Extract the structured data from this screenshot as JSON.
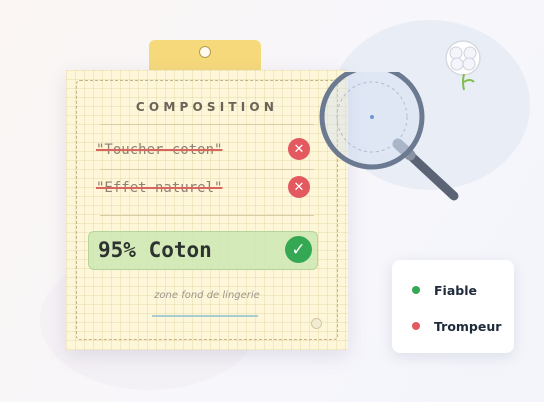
{
  "label": {
    "title": "COMPOSITION",
    "claims": [
      {
        "text": "\"Toucher coton\"",
        "verdict": "misleading"
      },
      {
        "text": "\"Effet naturel\"",
        "verdict": "misleading"
      }
    ],
    "composition": "95% Coton",
    "composition_verdict": "reliable",
    "zone_text": "zone fond de lingerie"
  },
  "legend": {
    "items": [
      {
        "label": "Fiable",
        "color": "#34a853"
      },
      {
        "label": "Trompeur",
        "color": "#e4585f"
      }
    ]
  },
  "icons": {
    "reject": "close-circle-icon",
    "approve": "check-circle-icon",
    "magnifier": "magnifying-glass-icon",
    "cotton": "cotton-flower-icon"
  }
}
